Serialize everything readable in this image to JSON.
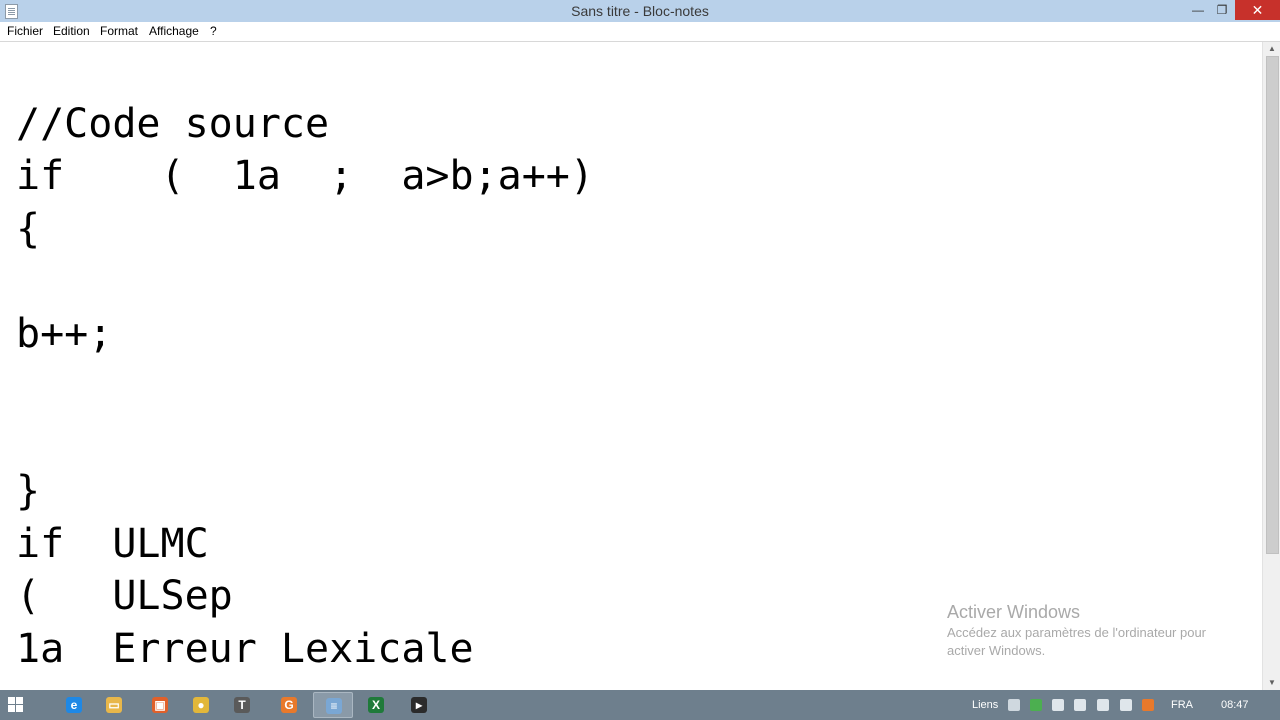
{
  "window": {
    "title": "Sans titre - Bloc-notes",
    "min_glyph": "—",
    "max_glyph": "❐",
    "close_glyph": "✕",
    "icon": "notepad-icon"
  },
  "menu": [
    "Fichier",
    "Edition",
    "Format",
    "Affichage",
    "?"
  ],
  "editor": {
    "lines": [
      "//Code source",
      "if    (  1a  ;  a>b;a++)",
      "{",
      "",
      "b++;",
      "",
      "",
      "",
      "}",
      "if  ULMC",
      "(   ULSep",
      "1a  Erreur Lexicale"
    ]
  },
  "watermark": {
    "title": "Activer Windows",
    "line1": "Accédez aux paramètres de l'ordinateur pour",
    "line2": "activer Windows."
  },
  "taskbar": {
    "apps": [
      {
        "name": "ie-icon",
        "glyph": "e",
        "color": "#1e88e5"
      },
      {
        "name": "explorer-icon",
        "glyph": "▭",
        "color": "#e8b74a"
      },
      {
        "name": "office-icon",
        "glyph": "▣",
        "color": "#e0602a"
      },
      {
        "name": "chrome-icon",
        "glyph": "●",
        "color": "#e2b73a"
      },
      {
        "name": "text-editor-icon",
        "glyph": "T",
        "color": "#5a5a5a"
      },
      {
        "name": "app-orange-icon",
        "glyph": "G",
        "color": "#e8792b"
      },
      {
        "name": "notepad-icon",
        "glyph": "≡",
        "color": "#7aa7d4"
      },
      {
        "name": "excel-icon",
        "glyph": "X",
        "color": "#1f7a3a"
      },
      {
        "name": "terminal-icon",
        "glyph": "▸",
        "color": "#2b2b2b"
      }
    ],
    "tray_links": "Liens",
    "language": "FRA",
    "clock": "08:47"
  }
}
